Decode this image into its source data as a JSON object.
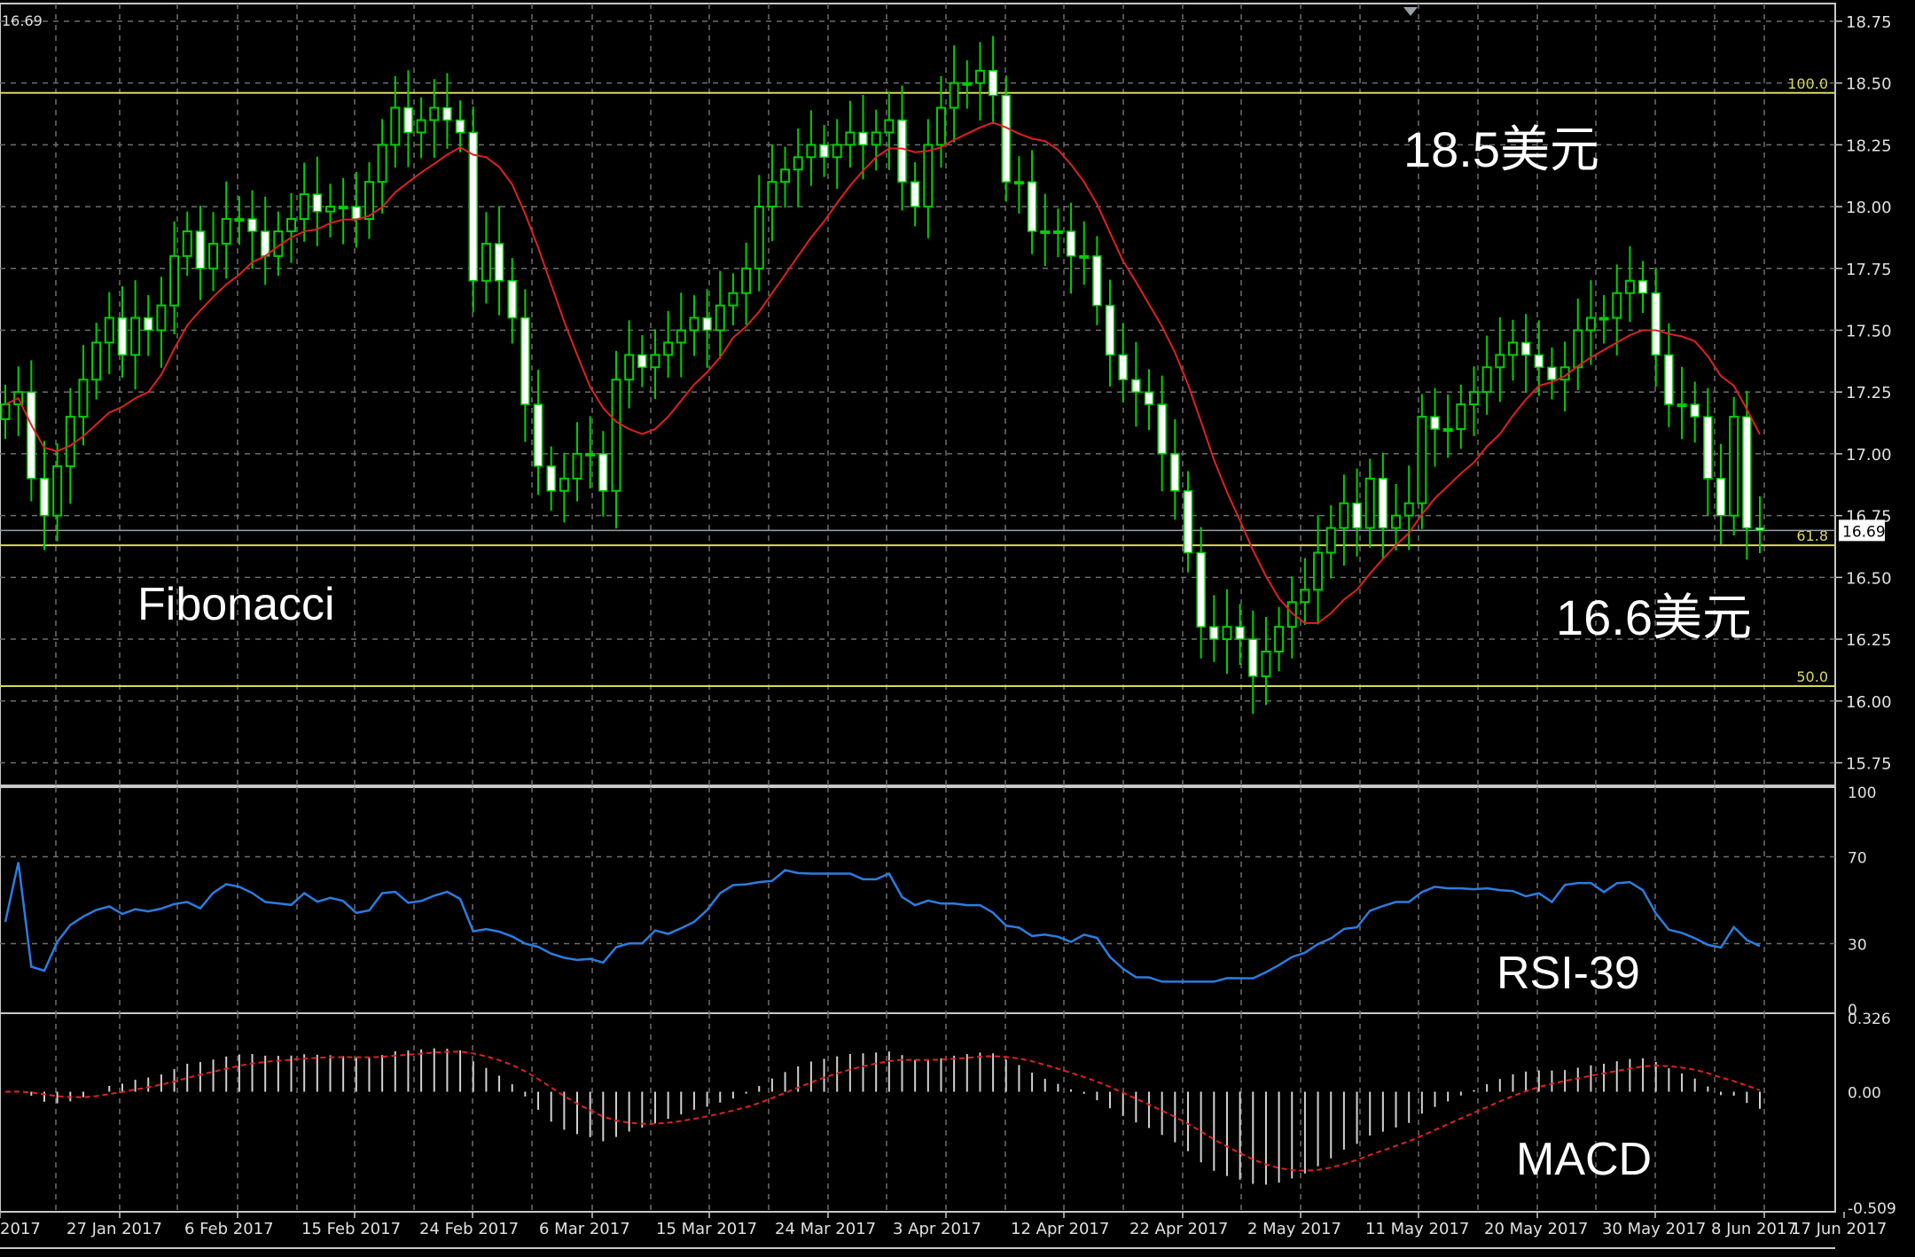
{
  "chart_data": {
    "type": "candlestick",
    "instrument_price_label": "16.69",
    "current_price": 16.69,
    "x_labels": [
      "2017",
      "27 Jan 2017",
      "6 Feb 2017",
      "15 Feb 2017",
      "24 Feb 2017",
      "6 Mar 2017",
      "15 Mar 2017",
      "24 Mar 2017",
      "3 Apr 2017",
      "12 Apr 2017",
      "22 Apr 2017",
      "2 May 2017",
      "11 May 2017",
      "20 May 2017",
      "30 May 2017",
      "8 Jun 2017",
      "17 Jun 2017"
    ],
    "price_panel": {
      "ylim": [
        15.68,
        18.8
      ],
      "ticks": [
        "18.75",
        "18.50",
        "18.25",
        "18.00",
        "17.75",
        "17.50",
        "17.25",
        "17.00",
        "16.75",
        "16.50",
        "16.25",
        "16.00",
        "15.75"
      ],
      "fib_levels": [
        {
          "label": "100.0",
          "value": 18.46
        },
        {
          "label": "61.8",
          "value": 16.63
        },
        {
          "label": "50.0",
          "value": 16.06
        }
      ],
      "annotations": {
        "top_target": "18.5美元",
        "bottom_target": "16.6美元",
        "fibonacci": "Fibonacci"
      },
      "closes": [
        17.2,
        17.25,
        16.9,
        16.75,
        16.95,
        17.15,
        17.3,
        17.45,
        17.55,
        17.4,
        17.55,
        17.5,
        17.6,
        17.8,
        17.9,
        17.75,
        17.85,
        17.95,
        17.95,
        17.9,
        17.8,
        17.9,
        17.95,
        18.05,
        17.98,
        18.0,
        18.0,
        17.95,
        18.1,
        18.25,
        18.4,
        18.3,
        18.35,
        18.4,
        18.35,
        18.3,
        17.7,
        17.85,
        17.7,
        17.55,
        17.2,
        16.95,
        16.85,
        16.9,
        17.0,
        17.0,
        16.85,
        17.3,
        17.4,
        17.35,
        17.4,
        17.45,
        17.5,
        17.55,
        17.5,
        17.6,
        17.65,
        17.75,
        18.0,
        18.1,
        18.15,
        18.2,
        18.25,
        18.2,
        18.25,
        18.3,
        18.25,
        18.3,
        18.35,
        18.1,
        18.0,
        18.25,
        18.4,
        18.5,
        18.5,
        18.55,
        18.45,
        18.1,
        18.1,
        17.9,
        17.9,
        17.9,
        17.8,
        17.8,
        17.6,
        17.4,
        17.3,
        17.25,
        17.2,
        17.0,
        16.85,
        16.6,
        16.3,
        16.25,
        16.3,
        16.25,
        16.1,
        16.2,
        16.3,
        16.4,
        16.45,
        16.6,
        16.7,
        16.8,
        16.7,
        16.9,
        16.7,
        16.75,
        16.8,
        17.15,
        17.1,
        17.1,
        17.2,
        17.25,
        17.35,
        17.4,
        17.45,
        17.4,
        17.35,
        17.3,
        17.35,
        17.5,
        17.55,
        17.55,
        17.65,
        17.7,
        17.65,
        17.4,
        17.2,
        17.2,
        17.15,
        16.9,
        16.75,
        17.15,
        16.7,
        16.69
      ]
    },
    "rsi_panel": {
      "label": "RSI-39",
      "ticks": [
        "100",
        "70",
        "30",
        "0"
      ],
      "ylim": [
        0,
        100
      ]
    },
    "macd_panel": {
      "label": "MACD",
      "ticks": [
        "0.326",
        "0.00",
        "-0.509"
      ],
      "ylim": [
        -0.509,
        0.326
      ]
    }
  }
}
